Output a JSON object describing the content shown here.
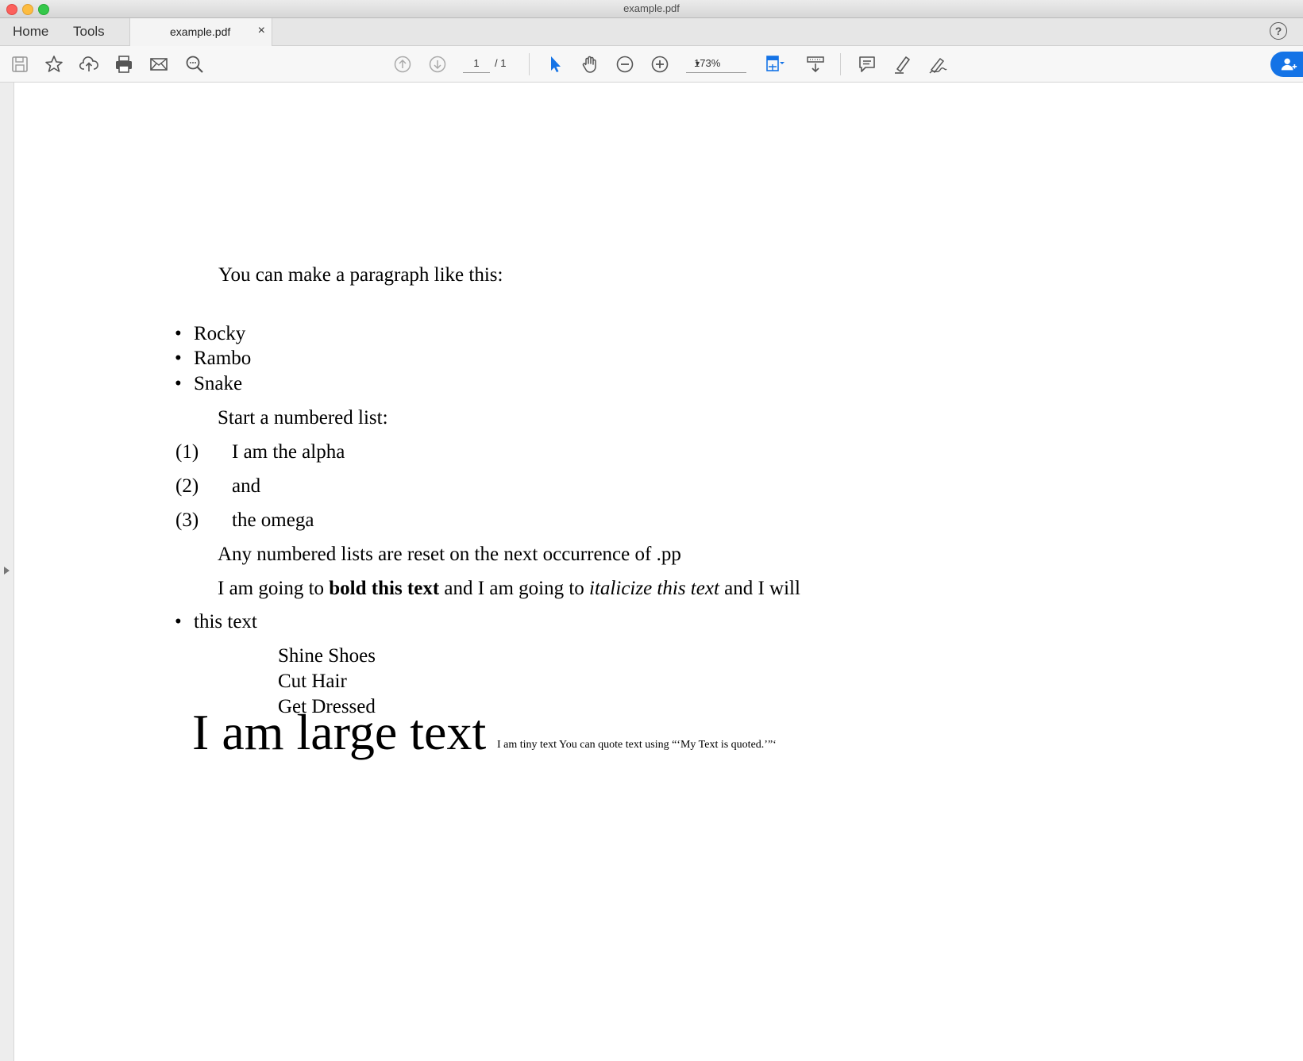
{
  "window": {
    "title": "example.pdf"
  },
  "tabs": {
    "home": "Home",
    "tools": "Tools",
    "document": "example.pdf",
    "close_glyph": "×",
    "help_glyph": "?"
  },
  "toolbar": {
    "page_current": "1",
    "page_total": "/ 1",
    "zoom": "173%",
    "icons": [
      "save-icon",
      "bookmark-star-icon",
      "upload-cloud-icon",
      "print-icon",
      "email-icon",
      "search-zoom-icon",
      "page-up-icon",
      "page-down-icon",
      "select-arrow-icon",
      "hand-icon",
      "zoom-out-icon",
      "zoom-in-icon",
      "fit-page-icon",
      "scroll-mode-icon",
      "comment-icon",
      "highlight-icon",
      "sign-icon",
      "share-user-icon"
    ],
    "accent_color": "#1473e6"
  },
  "document": {
    "paragraph_intro": "You can make a paragraph like this:",
    "bullets": [
      "Rocky",
      "Rambo",
      "Snake"
    ],
    "bullet_glyph": "•",
    "numbered_intro": "Start a numbered list:",
    "numbered": [
      {
        "num": "(1)",
        "text": "I am the alpha"
      },
      {
        "num": "(2)",
        "text": "and"
      },
      {
        "num": "(3)",
        "text": "the omega"
      }
    ],
    "reset_note": "Any numbered lists are reset on the next occurrence of .pp",
    "format_line": {
      "part1": "I am going to ",
      "bold": "bold this text",
      "part2": " and I am going to ",
      "italic": "italicize this text",
      "part3": " and I will"
    },
    "bullet_this_text": "this text",
    "indented": [
      "Shine Shoes",
      "Cut Hair",
      "Get Dressed"
    ],
    "large_text": "I am large text",
    "tiny_text": "I am tiny text You can quote text using “‘My Text is quoted.’”‘"
  }
}
